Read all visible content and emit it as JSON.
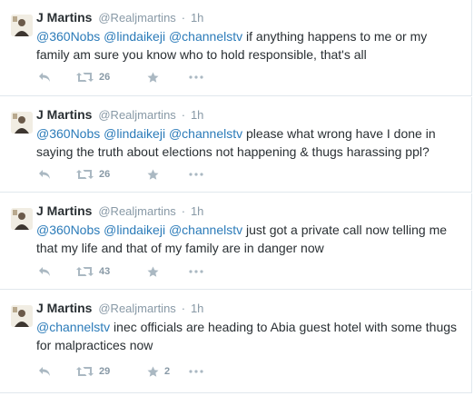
{
  "tweets": [
    {
      "name": "J Martins",
      "handle": "@Realjmartins",
      "sep": "·",
      "time": "1h",
      "mentions": [
        "@360Nobs",
        "@lindaikeji",
        "@channelstv"
      ],
      "text": " if anything happens to me or my family am sure you know who to hold responsible, that's all",
      "retweets": "26",
      "favorites": ""
    },
    {
      "name": "J Martins",
      "handle": "@Realjmartins",
      "sep": "·",
      "time": "1h",
      "mentions": [
        "@360Nobs",
        "@lindaikeji",
        "@channelstv"
      ],
      "text": "  please what wrong have I done in saying the truth about elections not happening & thugs harassing ppl?",
      "retweets": "26",
      "favorites": ""
    },
    {
      "name": "J Martins",
      "handle": "@Realjmartins",
      "sep": "·",
      "time": "1h",
      "mentions": [
        "@360Nobs",
        "@lindaikeji",
        "@channelstv"
      ],
      "text": "  just got a private call now telling me that my life and that of my family are in danger now",
      "retweets": "43",
      "favorites": ""
    },
    {
      "name": "J Martins",
      "handle": "@Realjmartins",
      "sep": "·",
      "time": "1h",
      "mentions": [
        "@channelstv"
      ],
      "text": "  inec officials are heading to Abia guest hotel with some thugs for malpractices now",
      "retweets": "29",
      "favorites": "2"
    }
  ],
  "icons": {
    "reply": "reply-icon",
    "retweet": "retweet-icon",
    "favorite": "star-icon",
    "more": "more-icon"
  },
  "colors": {
    "mention": "#2b7bb9",
    "muted": "#8899a6",
    "icon": "#aab8c2",
    "border": "#e1e8ed"
  }
}
